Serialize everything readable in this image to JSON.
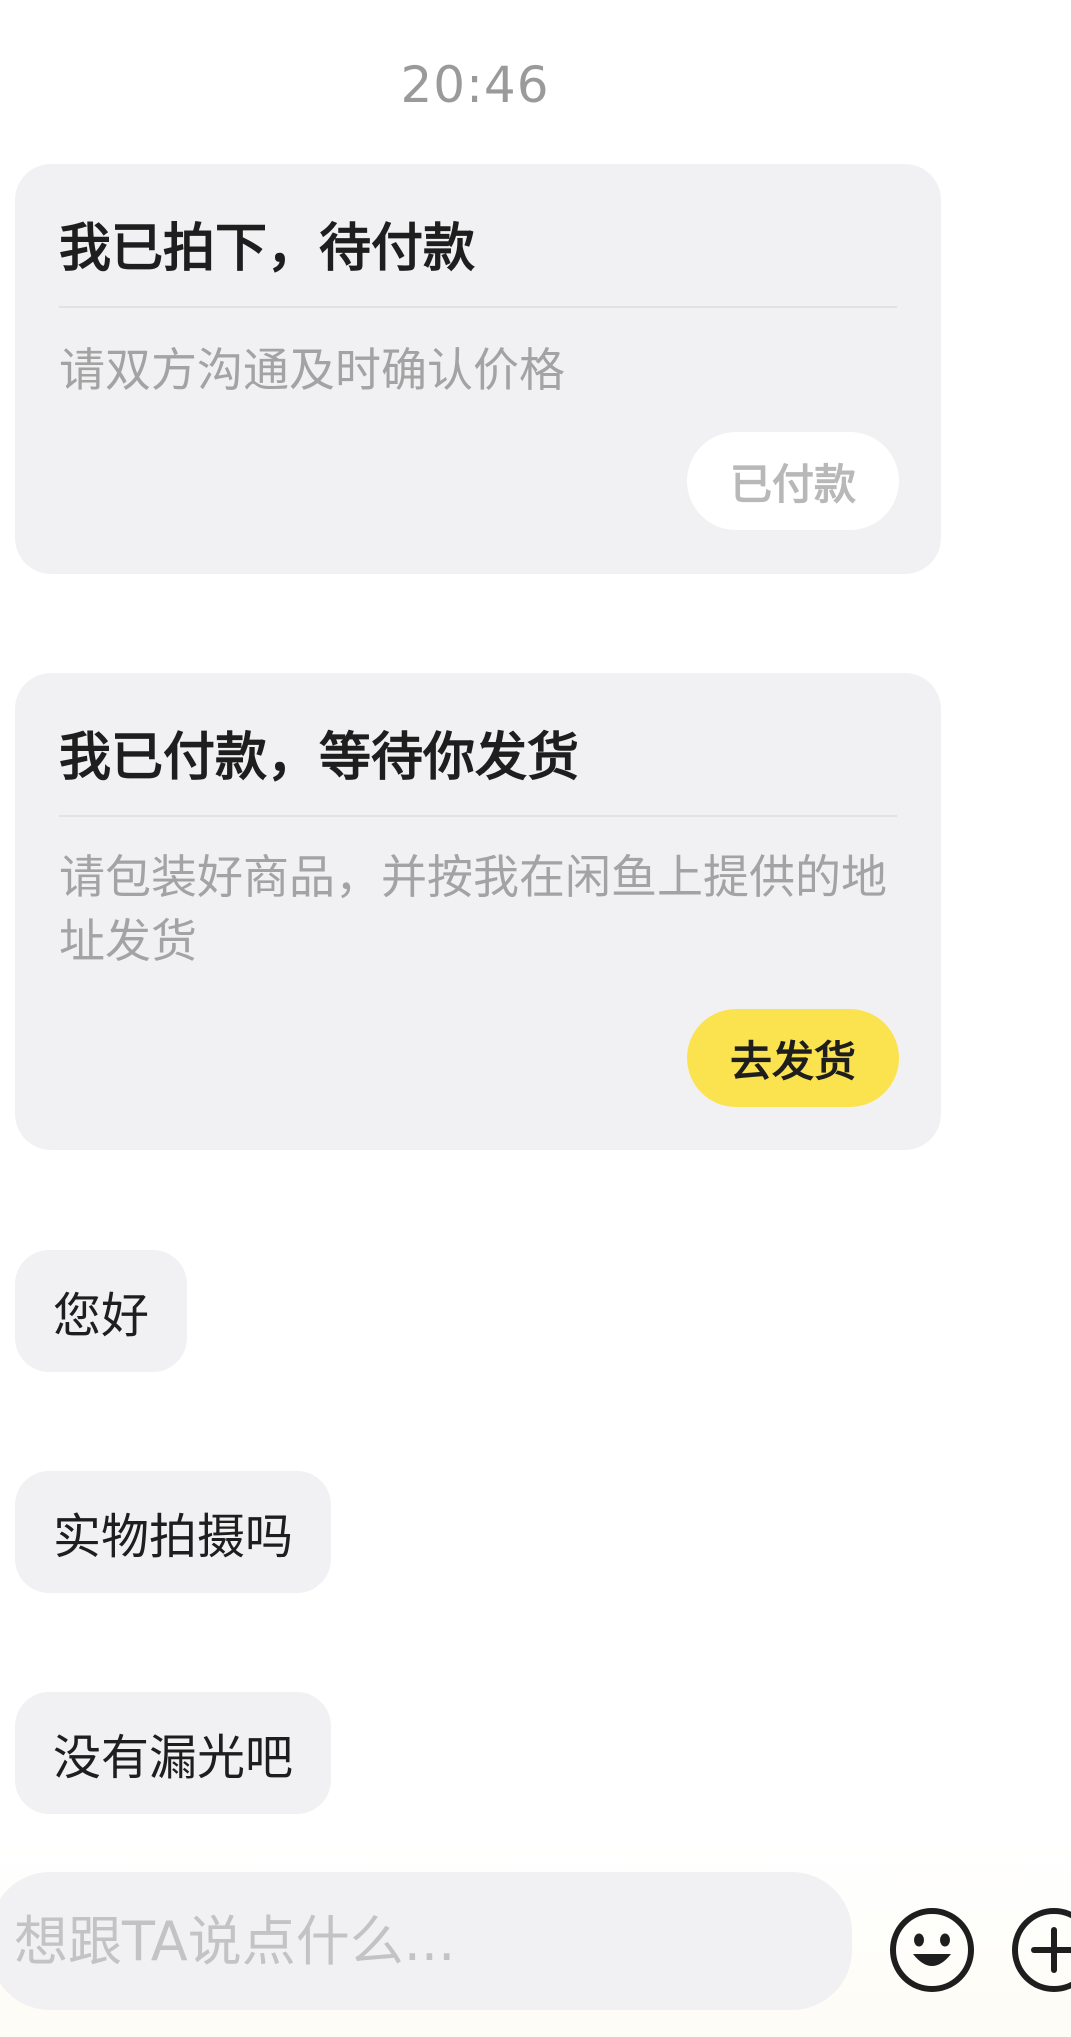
{
  "chat": {
    "timestamp": "20:46",
    "cards": [
      {
        "title": "我已拍下，待付款",
        "description": "请双方沟通及时确认价格",
        "button_label": "已付款"
      },
      {
        "title": "我已付款，等待你发货",
        "description": "请包装好商品，并按我在闲鱼上提供的地址发货",
        "button_label": "去发货"
      }
    ],
    "messages": [
      {
        "text": "您好"
      },
      {
        "text": "实物拍摄吗"
      },
      {
        "text": "没有漏光吧"
      }
    ]
  },
  "composer": {
    "placeholder": "想跟TA说点什么...",
    "value": "",
    "emoji_icon": "emoji-icon",
    "plus_icon": "plus-icon"
  },
  "colors": {
    "accent": "#fbe350",
    "card_bg": "#f1f1f3",
    "muted_text": "#a3a3a3"
  }
}
